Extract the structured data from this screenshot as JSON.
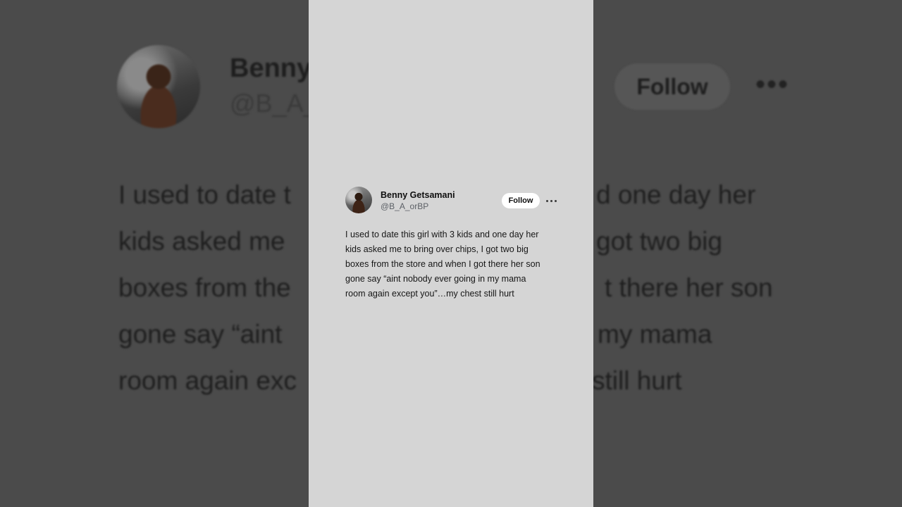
{
  "tweet": {
    "author_name": "Benny Getsamani",
    "author_handle": "@B_A_orBP",
    "follow_label": "Follow",
    "more_icon": "more-horizontal-icon",
    "text_lines": [
      "I used to date this girl with 3 kids and one day her",
      "kids asked me to bring over chips, I got two big",
      "boxes from the store and when I got there her son",
      "gone say “aint nobody ever going in my mama",
      "room again except you”…my chest still hurt"
    ]
  },
  "background": {
    "name_fragment": "Benny",
    "handle_fragment": "@B_A_",
    "follow_label": "Follow",
    "text_lines": [
      {
        "left": "I used to date t",
        "right": "d one day her"
      },
      {
        "left": "kids asked me",
        "right": "got two big"
      },
      {
        "left": "boxes from the",
        "right": "t there her son"
      },
      {
        "left": "gone say “aint",
        "right": "my mama"
      },
      {
        "left": "room again exc",
        "right": "still hurt"
      }
    ]
  },
  "colors": {
    "panel_bg": "#d5d5d5",
    "outer_bg": "#4a4a4a",
    "follow_bg": "#ffffff"
  }
}
